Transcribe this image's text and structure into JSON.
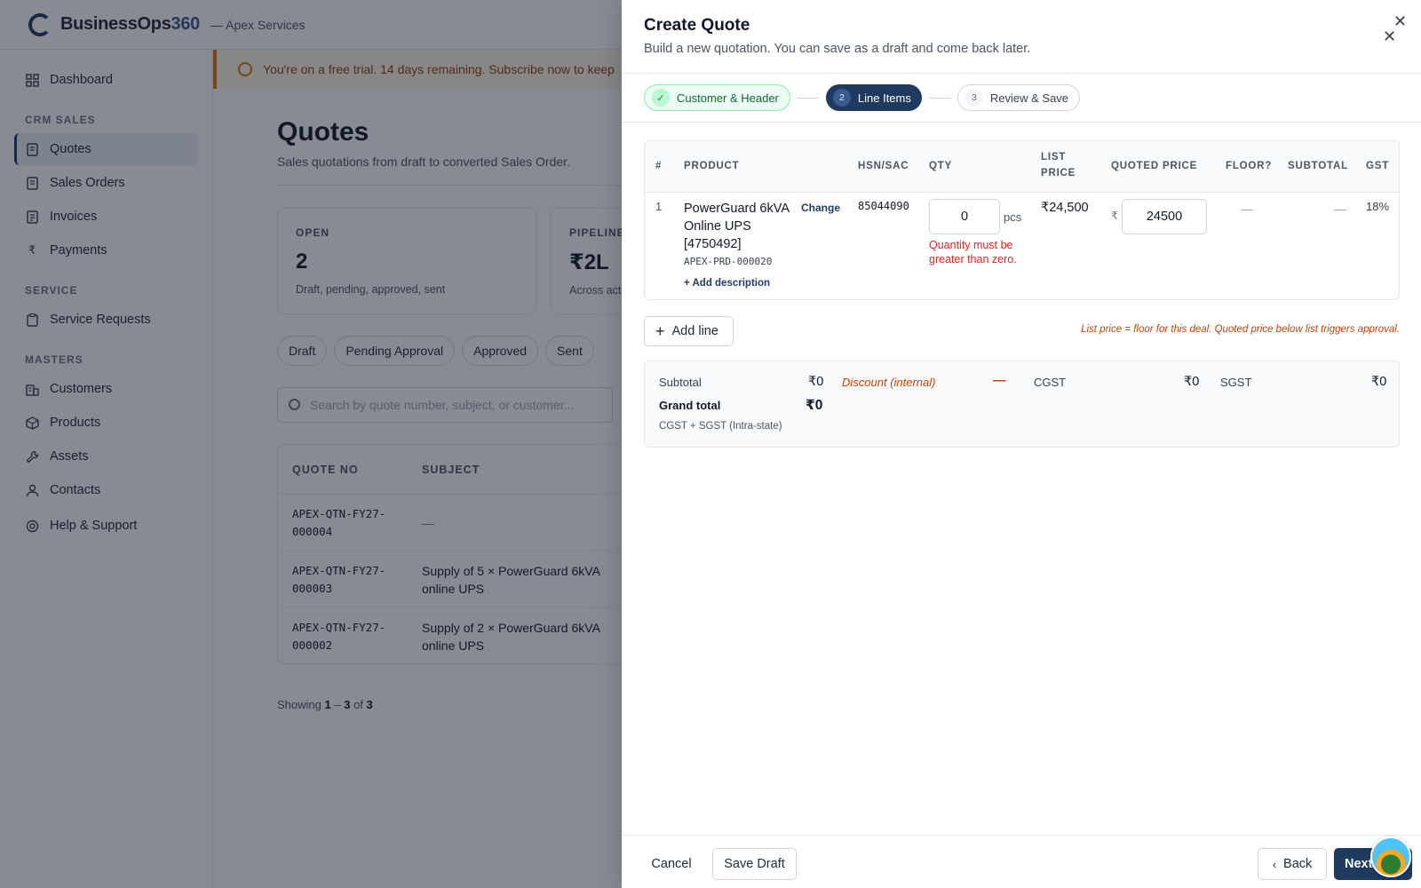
{
  "app": {
    "brand_prefix": "BusinessOps",
    "brand_suffix": "360",
    "org": "— Apex Services"
  },
  "sidebar": {
    "dashboard": "Dashboard",
    "sections": {
      "crm": "CRM SALES",
      "service": "SERVICE",
      "masters": "MASTERS"
    },
    "items": {
      "quotes": "Quotes",
      "sales_orders": "Sales Orders",
      "invoices": "Invoices",
      "payments": "Payments",
      "service_requests": "Service Requests",
      "customers": "Customers",
      "products": "Products",
      "assets": "Assets",
      "contacts": "Contacts",
      "help": "Help & Support"
    }
  },
  "main": {
    "trial": "You're on a free trial. 14 days remaining. Subscribe now to keep",
    "title": "Quotes",
    "subtitle": "Sales quotations from draft to converted Sales Order.",
    "stats": [
      {
        "key": "OPEN",
        "value": "2",
        "desc": "Draft, pending, approved, sent"
      },
      {
        "key": "PIPELINE",
        "value": "₹2L",
        "desc": "Across act"
      }
    ],
    "chips": [
      "Draft",
      "Pending Approval",
      "Approved",
      "Sent"
    ],
    "search_placeholder": "Search by quote number, subject, or customer...",
    "table": {
      "headers": {
        "quote_no": "QUOTE NO",
        "subject": "SUBJECT"
      },
      "rows": [
        {
          "no_a": "APEX-QTN-FY27-",
          "no_b": "000004",
          "subj_a": "—",
          "subj_b": ""
        },
        {
          "no_a": "APEX-QTN-FY27-",
          "no_b": "000003",
          "subj_a": "Supply of 5 × PowerGuard 6kVA",
          "subj_b": "online UPS"
        },
        {
          "no_a": "APEX-QTN-FY27-",
          "no_b": "000002",
          "subj_a": "Supply of 2 × PowerGuard 6kVA",
          "subj_b": "online UPS"
        }
      ]
    },
    "showing": {
      "prefix": "Showing",
      "from": "1",
      "sep": "–",
      "to": "3",
      "of": "of",
      "total": "3"
    }
  },
  "drawer": {
    "title": "Create Quote",
    "subtitle": "Build a new quotation. You can save as a draft and come back later.",
    "steps": [
      {
        "badge": "✓",
        "label": "Customer & Header",
        "state": "done"
      },
      {
        "badge": "2",
        "label": "Line Items",
        "state": "current"
      },
      {
        "badge": "3",
        "label": "Review & Save",
        "state": "next"
      }
    ],
    "lines": {
      "headers": {
        "num": "#",
        "product": "PRODUCT",
        "hsn": "HSN/SAC",
        "qty": "QTY",
        "list_price_a": "LIST",
        "list_price_b": "PRICE",
        "quoted_price": "QUOTED PRICE",
        "floor": "FLOOR?",
        "subtotal": "SUBTOTAL",
        "gst": "GST"
      },
      "row": {
        "num": "1",
        "product_name": "PowerGuard 6kVA Online UPS [4750492]",
        "change": "Change",
        "sku": "APEX-PRD-000020",
        "add_description": "+ Add description",
        "hsn": "85044090",
        "qty": "0",
        "unit": "pcs",
        "qty_error": "Quantity must be greater than zero.",
        "list_price": "₹24,500",
        "currency": "₹",
        "quoted_price": "24500",
        "floor": "—",
        "subtotal": "—",
        "gst": "18%"
      }
    },
    "add_line": "Add line",
    "note": "List price = floor for this deal. Quoted price below list triggers approval.",
    "totals": {
      "subtotal_label": "Subtotal",
      "subtotal": "₹0",
      "discount_label": "Discount (internal)",
      "discount": "—",
      "cgst_label": "CGST",
      "cgst": "₹0",
      "sgst_label": "SGST",
      "sgst": "₹0",
      "grand_label": "Grand total",
      "grand": "₹0",
      "tax_note": "CGST + SGST (Intra-state)"
    },
    "footer": {
      "cancel": "Cancel",
      "save_draft": "Save Draft",
      "back": "Back",
      "next": "Next"
    }
  },
  "colors": {
    "primary": "#1f3a5f",
    "success": "#166534",
    "error": "#dc2626",
    "warning": "#c2410c"
  }
}
